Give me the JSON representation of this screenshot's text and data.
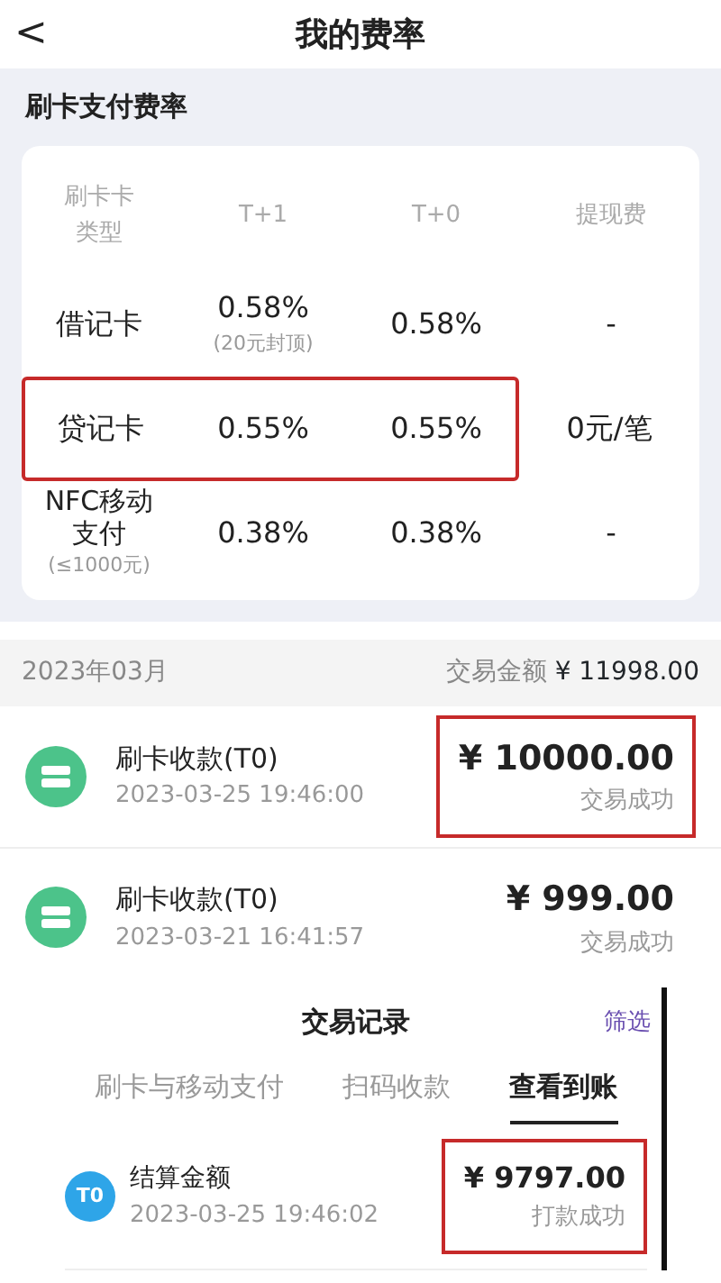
{
  "header": {
    "back": "<",
    "title": "我的费率"
  },
  "rates": {
    "title": "刷卡支付费率",
    "columns": [
      "刷卡卡类型",
      "T+1",
      "T+0",
      "提现费"
    ],
    "rows": [
      {
        "type": "借记卡",
        "t1": "0.58%",
        "t1_note": "(20元封顶)",
        "t0": "0.58%",
        "fee": "-",
        "highlighted": false
      },
      {
        "type": "贷记卡",
        "t1": "0.55%",
        "t0": "0.55%",
        "fee": "0元/笔",
        "highlighted": true
      },
      {
        "type": "NFC移动支付",
        "note": "(≤1000元)",
        "t1": "0.38%",
        "t0": "0.38%",
        "fee": "-",
        "highlighted": false
      }
    ]
  },
  "month": {
    "label": "2023年03月",
    "total_label": "交易金额",
    "total": "¥ 11998.00"
  },
  "transactions": [
    {
      "title": "刷卡收款(T0)",
      "time": "2023-03-25 19:46:00",
      "amount": "¥ 10000.00",
      "status": "交易成功",
      "highlighted": true
    },
    {
      "title": "刷卡收款(T0)",
      "time": "2023-03-21 16:41:57",
      "amount": "¥ 999.00",
      "status": "交易成功",
      "highlighted": false
    }
  ],
  "records": {
    "title": "交易记录",
    "filter": "筛选",
    "tabs": [
      {
        "label": "刷卡与移动支付",
        "selected": false
      },
      {
        "label": "扫码收款",
        "selected": false
      },
      {
        "label": "查看到账",
        "selected": true
      }
    ],
    "rows": [
      {
        "badge": "T0",
        "title": "结算金额",
        "time": "2023-03-25 19:46:02",
        "amount": "¥ 9797.00",
        "status": "打款成功",
        "highlighted": true
      }
    ]
  }
}
